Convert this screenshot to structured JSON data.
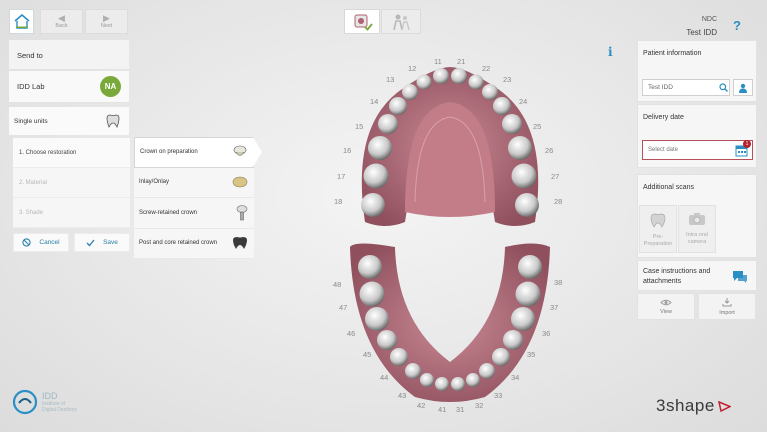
{
  "nav": {
    "back_label": "Back",
    "next_label": "Next"
  },
  "left": {
    "send_to_label": "Send to",
    "lab_name": "IDD Lab",
    "lab_initials": "NA",
    "single_units_label": "Single units",
    "steps": [
      "1. Choose restoration",
      "2. Material",
      "3. Shade"
    ],
    "cancel_label": "Cancel",
    "save_label": "Save"
  },
  "restorations": [
    {
      "label": "Crown on preparation"
    },
    {
      "label": "Inlay/Onlay"
    },
    {
      "label": "Screw-retained crown"
    },
    {
      "label": "Post and core retained crown"
    }
  ],
  "header": {
    "ndc": "NDC",
    "patient": "Test IDD",
    "help": "?"
  },
  "info_glyph": "i",
  "right": {
    "patient_info_title": "Patient information",
    "patient_value": "Test IDD",
    "delivery_title": "Delivery date",
    "date_placeholder": "Select date",
    "date_badge": "1",
    "additional_scans_title": "Additional scans",
    "scan_pre_label": "Pre-Preparation",
    "scan_intraoral_label": "Intra oral camera",
    "case_title": "Case instructions and attachments",
    "view_label": "View",
    "import_label": "Import"
  },
  "teeth": {
    "upper": [
      "11",
      "12",
      "13",
      "14",
      "15",
      "16",
      "17",
      "18",
      "21",
      "22",
      "23",
      "24",
      "25",
      "26",
      "27",
      "28"
    ],
    "lower": [
      "31",
      "32",
      "33",
      "34",
      "35",
      "36",
      "37",
      "38",
      "41",
      "42",
      "43",
      "44",
      "45",
      "46",
      "47",
      "48"
    ]
  },
  "logos": {
    "idd_name": "IDD",
    "idd_sub1": "Institute of",
    "idd_sub2": "Digital Dentistry",
    "brand": "3shape"
  },
  "colors": {
    "accent": "#2a8fc4",
    "badge_green": "#7aa93b",
    "gum": "#b5707f",
    "alert_red": "#b5202e"
  }
}
